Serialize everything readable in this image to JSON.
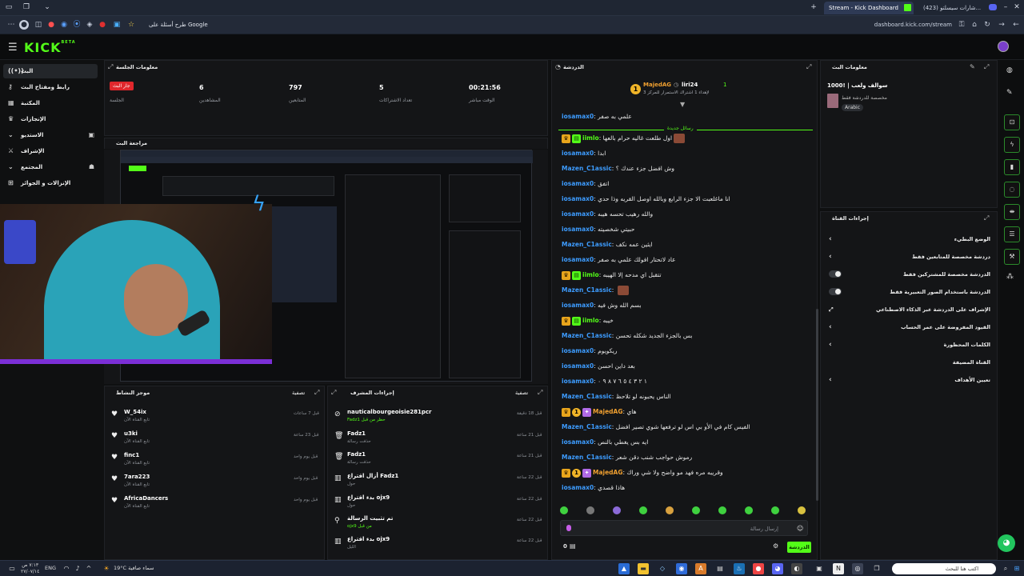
{
  "browser": {
    "tabs": [
      {
        "label": "Stream - Kick Dashboard",
        "active": true
      },
      {
        "label": "(423) شارات سيسلتو...",
        "active": false
      }
    ],
    "new_tab": "+",
    "url": "dashboard.kick.com/stream",
    "search_pill": "طرح أسئلة على Google"
  },
  "app": {
    "logo": "KICK",
    "logo_beta": "BETA"
  },
  "sidebar": {
    "items": [
      {
        "label": "البث",
        "icon": "broadcast-icon",
        "active": true
      },
      {
        "label": "رابط ومفتاح البث",
        "icon": "key-icon"
      },
      {
        "label": "المكتبة",
        "icon": "library-icon"
      },
      {
        "label": "الإنجازات",
        "icon": "trophy-icon"
      },
      {
        "label": "الاستديو",
        "icon": "studio-icon"
      },
      {
        "label": "الإشراف",
        "icon": "shield-icon"
      },
      {
        "label": "المجتمع",
        "icon": "community-icon"
      },
      {
        "label": "الإنزالات و الجوائز",
        "icon": "gift-icon"
      }
    ]
  },
  "session": {
    "title": "معلومات الجلسة",
    "live_badge": "جار البث",
    "live_sub": "الجلسة",
    "stats": [
      {
        "value": "6",
        "label": "المشاهدين"
      },
      {
        "value": "797",
        "label": "المتابعين"
      },
      {
        "value": "5",
        "label": "تعداد الاشتراكات"
      },
      {
        "value": "00:21:56",
        "label": "الوقت مباشر"
      }
    ]
  },
  "preview": {
    "title": "مراجعة البث"
  },
  "activity": {
    "title": "موجز النشاط",
    "filter": "تصفية",
    "items": [
      {
        "name": "W_54ix",
        "sub": "تابع القناة الآن",
        "time": "قبل 7 ساعات"
      },
      {
        "name": "u3ki",
        "sub": "تابع القناة الآن",
        "time": "قبل 23 ساعة"
      },
      {
        "name": "finc1",
        "sub": "تابع القناة الآن",
        "time": "قبل يوم واحد"
      },
      {
        "name": "7ara223",
        "sub": "تابع القناة الآن",
        "time": "قبل يوم واحد"
      },
      {
        "name": "AfricaDancers",
        "sub": "تابع القناة الآن",
        "time": "قبل يوم واحد"
      }
    ]
  },
  "modlog": {
    "title": "إجراءات المشرف",
    "filter": "تصفية",
    "items": [
      {
        "name": "nauticalbourgeoisie281pcr",
        "sub": "Fadz1 حظر من قبل",
        "time": "قبل 18 دقيقة",
        "icon": "ban-icon"
      },
      {
        "name": "Fadz1",
        "sub": "حذفت رسالة",
        "time": "قبل 21 ساعة",
        "icon": "trash-icon"
      },
      {
        "name": "Fadz1",
        "sub": "حذفت رسالة",
        "time": "قبل 21 ساعة",
        "icon": "trash-icon"
      },
      {
        "name": "أزال اقتراع Fadz1",
        "sub": "حول",
        "time": "قبل 22 ساعة",
        "icon": "poll-icon"
      },
      {
        "name": "بدء اقتراع ojx9",
        "sub": "حول",
        "time": "قبل 22 ساعة",
        "icon": "poll-icon"
      },
      {
        "name": "تم تثبيت الرسالة",
        "sub": "ojx9 من قبل",
        "time": "قبل 22 ساعة",
        "icon": "pin-icon"
      },
      {
        "name": "بدء اقتراع ojx9",
        "sub": "الليل",
        "time": "قبل 22 ساعة",
        "icon": "poll-icon"
      }
    ]
  },
  "chat": {
    "title": "الدردشة",
    "pinned": {
      "user1": "MajedAG",
      "user2": "liri24",
      "count": "1",
      "text": "لإهداء 1 اشتراك الاستمرار للمركز 3"
    },
    "new_messages_label": "رسائل جديدة",
    "messages": [
      {
        "user": "iosamax0",
        "text": "علمي به صفر",
        "color": "blue"
      },
      {
        "user": "iimlo",
        "text": "اول طلعت غاليه حرام بالعها",
        "color": "green",
        "badges": [
          "crown",
          "sub"
        ],
        "emote": true
      },
      {
        "user": "iosamax0",
        "text": "ابدا",
        "color": "blue"
      },
      {
        "user": "Mazen_C1assic",
        "text": "وش افضل جزء عندك ؟",
        "color": "blue"
      },
      {
        "user": "iosamax0",
        "text": "اتفق",
        "color": "blue"
      },
      {
        "user": "iosamax0",
        "text": "انا ماغلعبت الا جزء الرابع وبالله اوصل القريه وذا حدي",
        "color": "blue"
      },
      {
        "user": "iosamax0",
        "text": "والله رهيب تحسه هيبه",
        "color": "blue"
      },
      {
        "user": "iosamax0",
        "text": "حبيتي شخصيته",
        "color": "blue"
      },
      {
        "user": "Mazen_C1assic",
        "text": "ايثين عمه نكف",
        "color": "blue"
      },
      {
        "user": "iosamax0",
        "text": "عاد لاتحتار افولك علمي به صفر",
        "color": "blue"
      },
      {
        "user": "iimlo",
        "text": "تتقبل اي مدحه إلا الهيبه",
        "color": "green",
        "badges": [
          "crown",
          "sub"
        ]
      },
      {
        "user": "Mazen_C1assic",
        "text": "",
        "color": "blue",
        "emote": true
      },
      {
        "user": "iosamax0",
        "text": "بسم الله وش فيه",
        "color": "blue"
      },
      {
        "user": "iimlo",
        "text": "خيبه",
        "color": "green",
        "badges": [
          "crown",
          "sub"
        ]
      },
      {
        "user": "Mazen_C1assic",
        "text": "بس بالجزء الجديد شكله تحسن",
        "color": "blue"
      },
      {
        "user": "iosamax0",
        "text": "ريكويوم",
        "color": "blue"
      },
      {
        "user": "iosamax0",
        "text": "بعد داين احسن",
        "color": "blue"
      },
      {
        "user": "iosamax0",
        "text": "١ ٢ ٣ ٤ ٥ ٦ ٧ ٨ ٩ ٠",
        "color": "blue"
      },
      {
        "user": "Mazen_C1assic",
        "text": "الناس يحبونه لو تلاحظ",
        "color": "blue"
      },
      {
        "user": "MajedAG",
        "text": "هاي",
        "color": "orange",
        "badges": [
          "crown",
          "one",
          "gift"
        ]
      },
      {
        "user": "Mazen_C1assic",
        "text": "الفيس كام في الأو بي اس لو ترفعها شوي تصير افضل",
        "color": "blue"
      },
      {
        "user": "iosamax0",
        "text": "ايه بس يغطي بالنص",
        "color": "blue"
      },
      {
        "user": "Mazen_C1assic",
        "text": "رموش حواجب شنب دقن شعر",
        "color": "blue"
      },
      {
        "user": "MajedAG",
        "text": "وقريبه مره فهد مو واضح ولا شي وراك",
        "color": "orange",
        "badges": [
          "crown",
          "one",
          "gift"
        ]
      },
      {
        "user": "iosamax0",
        "text": "هاذا قصدي",
        "color": "blue"
      }
    ],
    "input_placeholder": "إرسال رسالة",
    "send_label": "الدردشة",
    "viewer_count": "0"
  },
  "stream_info": {
    "title": "معلومات البث",
    "stream_title": "سوالف ولعب | !1000",
    "category": "مخصصة للدردشة فقط",
    "language": "Arabic"
  },
  "channel_actions": {
    "title": "إجراءات القناة",
    "rows": [
      {
        "label": "الوضع البطيء",
        "kind": "chevron"
      },
      {
        "label": "دردشة مخصصة للمتابعين فقط",
        "kind": "chevron"
      },
      {
        "label": "الدردشة مخصصة للمشتركين فقط",
        "kind": "toggle"
      },
      {
        "label": "الدردشة باستخدام الصور التعبيرية فقط",
        "kind": "toggle"
      },
      {
        "label": "الإشراف على الدردشة عبر الذكاء الاصطناعي",
        "kind": "external"
      },
      {
        "label": "القيود المفروضة على عمر الحساب",
        "kind": "chevron"
      },
      {
        "label": "الكلمات المحظورة",
        "kind": "chevron"
      },
      {
        "label": "القناة المضيفة",
        "kind": "none"
      },
      {
        "label": "تعيين الأهداف",
        "kind": "chevron"
      }
    ]
  },
  "taskbar": {
    "search": "اكتب هنا للبحث",
    "weather": "19°C سماء صافية",
    "lang": "ENG",
    "time": "٧:١٣ ص",
    "date": "٢٧/٠٧/١٤"
  }
}
